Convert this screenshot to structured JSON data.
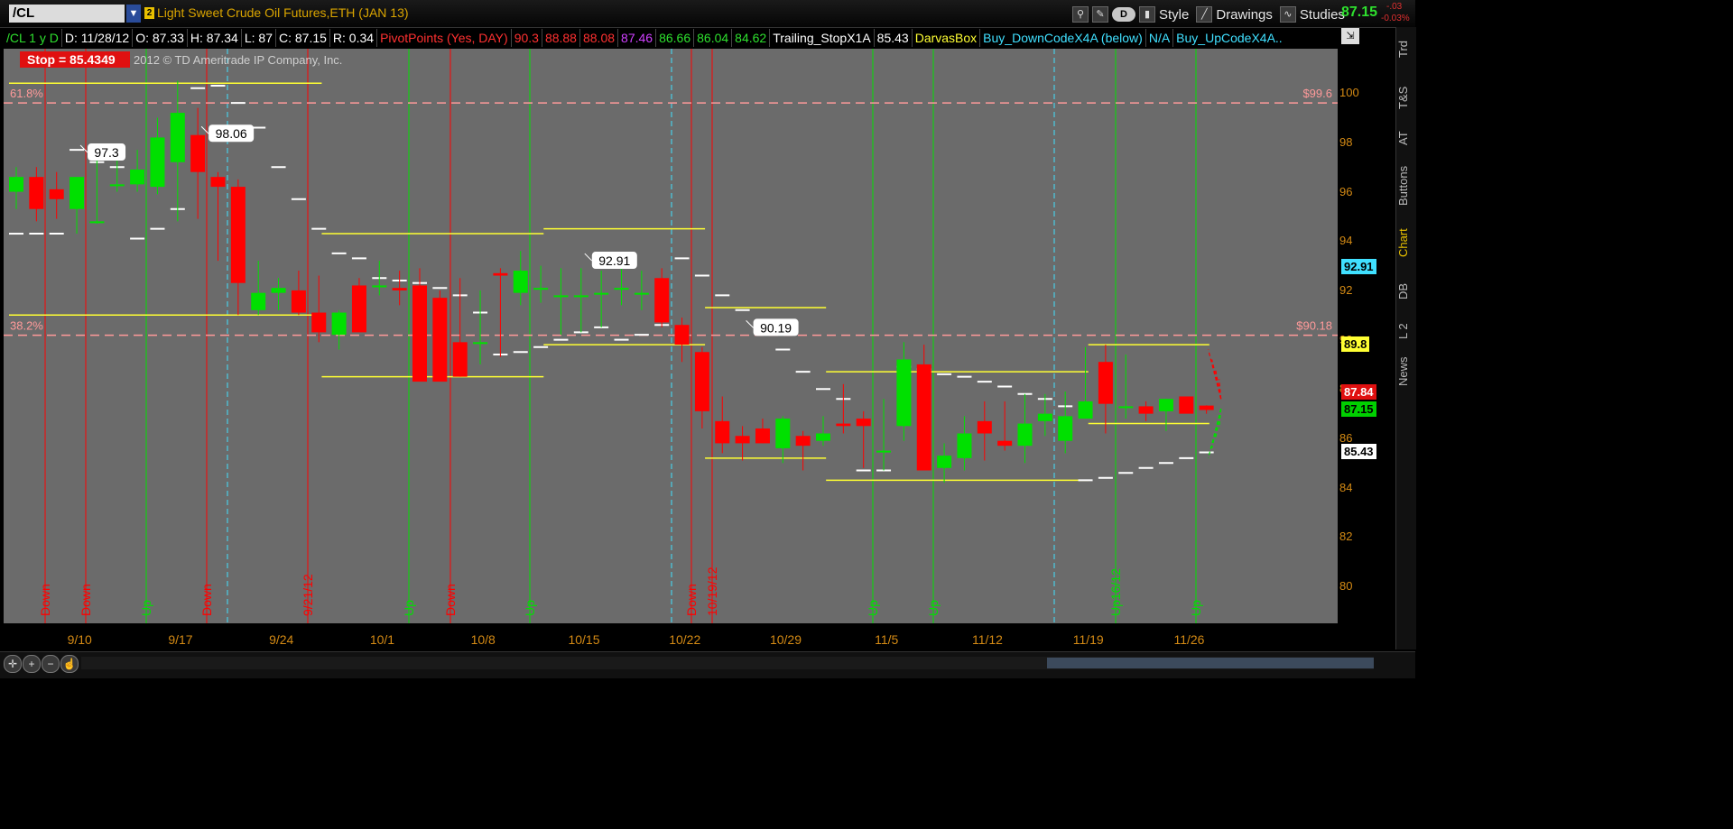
{
  "header": {
    "symbol": "/CL",
    "instrument_number": "2",
    "instrument_name": "Light Sweet Crude Oil Futures,ETH (JAN 13)",
    "tools": {
      "d_button": "D",
      "style": "Style",
      "drawings": "Drawings",
      "studies": "Studies"
    },
    "last_price": "87.15",
    "change": "-.03",
    "change_pct": "-0.03%"
  },
  "infobar": {
    "period": "/CL 1 y D",
    "date": "D: 11/28/12",
    "open": "O: 87.33",
    "high": "H: 87.34",
    "low": "L: 87",
    "close": "C: 87.15",
    "range": "R: 0.34",
    "pivot_title": "PivotPoints (Yes, DAY)",
    "pivot_values": [
      "90.3",
      "88.88",
      "88.08",
      "87.46",
      "86.66",
      "86.04",
      "84.62"
    ],
    "trailing": "Trailing_StopX1A",
    "trailing_value": "85.43",
    "darvas": "DarvasBox",
    "buy_down": "Buy_DownCodeX4A (below)",
    "na": "N/A",
    "buy_up": "Buy_UpCodeX4A.."
  },
  "overlay": {
    "stop_label": "Stop =  85.4349",
    "copyright": "2012 © TD Ameritrade IP Company, Inc."
  },
  "fib": {
    "level_618": "61.8%",
    "level_382": "38.2%",
    "price_618": "$99.6",
    "price_382": "$90.18"
  },
  "callouts": [
    "97.3",
    "98.06",
    "92.91",
    "90.19"
  ],
  "price_axis": {
    "ticks": [
      "100",
      "98",
      "96",
      "94",
      "92",
      "90",
      "88",
      "86",
      "84",
      "82",
      "80"
    ],
    "tags": {
      "p9291": "92.91",
      "p898": "89.8",
      "p8784": "87.84",
      "p8715": "87.15",
      "p8543": "85.43"
    }
  },
  "date_axis": [
    "9/10",
    "9/17",
    "9/24",
    "10/1",
    "10/8",
    "10/15",
    "10/22",
    "10/29",
    "11/5",
    "11/12",
    "11/19",
    "11/26"
  ],
  "signal_labels": [
    "Down",
    "Down",
    "Up",
    "Down",
    "9/21/12",
    "Up",
    "Down",
    "Up",
    "Down",
    "10/19/12",
    "Up",
    "Up",
    "Up16/12",
    "Up"
  ],
  "side_tabs": [
    "Trd",
    "T&S",
    "AT",
    "Buttons",
    "Chart",
    "DB",
    "L 2",
    "News"
  ],
  "colors": {
    "up": "#00e000",
    "down": "#ff0000",
    "darvas": "#ffff33",
    "fib": "#ff9a9a",
    "trail": "#ffffff",
    "price_text": "#d48a14",
    "bg": "#6b6b6b"
  },
  "chart_data": {
    "type": "candlestick",
    "x": [
      "9/5",
      "9/6",
      "9/7",
      "9/10",
      "9/11",
      "9/12",
      "9/13",
      "9/14",
      "9/17",
      "9/18",
      "9/19",
      "9/20",
      "9/21",
      "9/24",
      "9/25",
      "9/26",
      "9/27",
      "9/28",
      "10/1",
      "10/2",
      "10/3",
      "10/4",
      "10/5",
      "10/8",
      "10/9",
      "10/10",
      "10/11",
      "10/12",
      "10/15",
      "10/16",
      "10/17",
      "10/18",
      "10/19",
      "10/22",
      "10/23",
      "10/24",
      "10/25",
      "10/26",
      "10/29",
      "10/30",
      "10/31",
      "11/1",
      "11/2",
      "11/5",
      "11/6",
      "11/7",
      "11/8",
      "11/9",
      "11/12",
      "11/13",
      "11/14",
      "11/15",
      "11/16",
      "11/19",
      "11/20",
      "11/21",
      "11/23",
      "11/26",
      "11/27",
      "11/28"
    ],
    "open": [
      96.0,
      96.6,
      96.1,
      95.3,
      94.8,
      96.3,
      96.3,
      96.2,
      97.2,
      98.3,
      96.6,
      96.2,
      91.2,
      91.9,
      92.0,
      91.1,
      90.2,
      92.2,
      92.2,
      92.1,
      92.2,
      91.7,
      89.9,
      89.9,
      92.7,
      91.9,
      92.1,
      91.8,
      91.8,
      91.9,
      92.1,
      91.9,
      92.5,
      90.6,
      89.5,
      86.7,
      86.1,
      86.4,
      85.6,
      86.1,
      85.9,
      86.6,
      86.8,
      85.5,
      86.5,
      89.0,
      84.8,
      85.2,
      86.7,
      85.9,
      85.7,
      86.7,
      85.9,
      86.8,
      89.1,
      87.3,
      87.3,
      87.1,
      87.7,
      87.33
    ],
    "high": [
      97.0,
      97.0,
      96.8,
      96.0,
      97.8,
      97.9,
      97.7,
      99.0,
      100.5,
      99.4,
      96.8,
      96.5,
      93.2,
      92.5,
      92.8,
      92.6,
      91.2,
      92.5,
      93.2,
      92.8,
      92.9,
      92.0,
      92.5,
      92.0,
      92.9,
      93.6,
      93.0,
      92.9,
      92.9,
      92.8,
      92.9,
      92.8,
      92.9,
      90.9,
      89.7,
      87.7,
      86.5,
      86.8,
      86.9,
      86.3,
      86.9,
      88.2,
      87.1,
      87.6,
      89.9,
      89.8,
      85.8,
      86.9,
      87.5,
      87.5,
      87.8,
      87.8,
      87.9,
      89.7,
      89.8,
      89.4,
      87.5,
      87.6,
      87.6,
      87.34
    ],
    "low": [
      95.3,
      94.8,
      94.9,
      94.3,
      94.7,
      96.0,
      96.0,
      95.9,
      94.8,
      94.9,
      93.2,
      91.0,
      91.0,
      91.2,
      91.0,
      89.9,
      89.6,
      90.8,
      91.8,
      91.4,
      91.1,
      88.5,
      88.5,
      89.0,
      89.3,
      91.4,
      91.5,
      90.2,
      90.3,
      90.5,
      91.4,
      91.2,
      90.5,
      89.1,
      86.4,
      85.4,
      85.1,
      85.8,
      85.0,
      84.7,
      85.7,
      86.2,
      84.8,
      84.7,
      85.9,
      85.8,
      84.2,
      84.7,
      85.1,
      85.5,
      85.0,
      86.1,
      85.4,
      86.8,
      86.2,
      86.8,
      86.7,
      86.3,
      87.5,
      87.0
    ],
    "close": [
      96.6,
      95.3,
      95.7,
      96.6,
      94.8,
      96.3,
      96.9,
      98.2,
      99.2,
      96.8,
      96.2,
      92.3,
      91.9,
      92.1,
      91.1,
      90.3,
      91.1,
      90.3,
      92.2,
      92.0,
      88.3,
      88.3,
      88.5,
      89.9,
      92.6,
      92.8,
      92.1,
      91.8,
      91.8,
      91.9,
      92.1,
      91.9,
      90.7,
      89.8,
      87.1,
      85.8,
      85.8,
      85.8,
      86.8,
      85.7,
      86.2,
      86.5,
      86.5,
      85.5,
      89.2,
      84.7,
      85.3,
      86.2,
      86.2,
      85.7,
      86.6,
      87.0,
      86.9,
      87.5,
      87.4,
      87.3,
      87.0,
      87.6,
      87.0,
      87.15
    ],
    "trailing_stop_values": [
      94.3,
      94.3,
      94.3,
      97.7,
      97.2,
      97.0,
      94.1,
      94.5,
      95.3,
      100.2,
      100.3,
      99.6,
      98.6,
      97.0,
      95.7,
      94.5,
      93.5,
      93.3,
      92.5,
      92.4,
      92.3,
      92.1,
      91.8,
      91.1,
      89.4,
      89.5,
      89.7,
      90.0,
      90.3,
      90.5,
      90.0,
      90.2,
      90.6,
      93.3,
      92.6,
      91.8,
      91.2,
      90.4,
      89.6,
      88.7,
      88.0,
      87.6,
      84.7,
      84.7,
      88.9,
      88.8,
      88.6,
      88.5,
      88.3,
      88.1,
      87.8,
      87.6,
      87.3,
      84.3,
      84.4,
      84.6,
      84.8,
      85.0,
      85.2,
      85.43
    ],
    "ylim": [
      78.5,
      101.8
    ],
    "ylabel": "",
    "xlabel": ""
  }
}
